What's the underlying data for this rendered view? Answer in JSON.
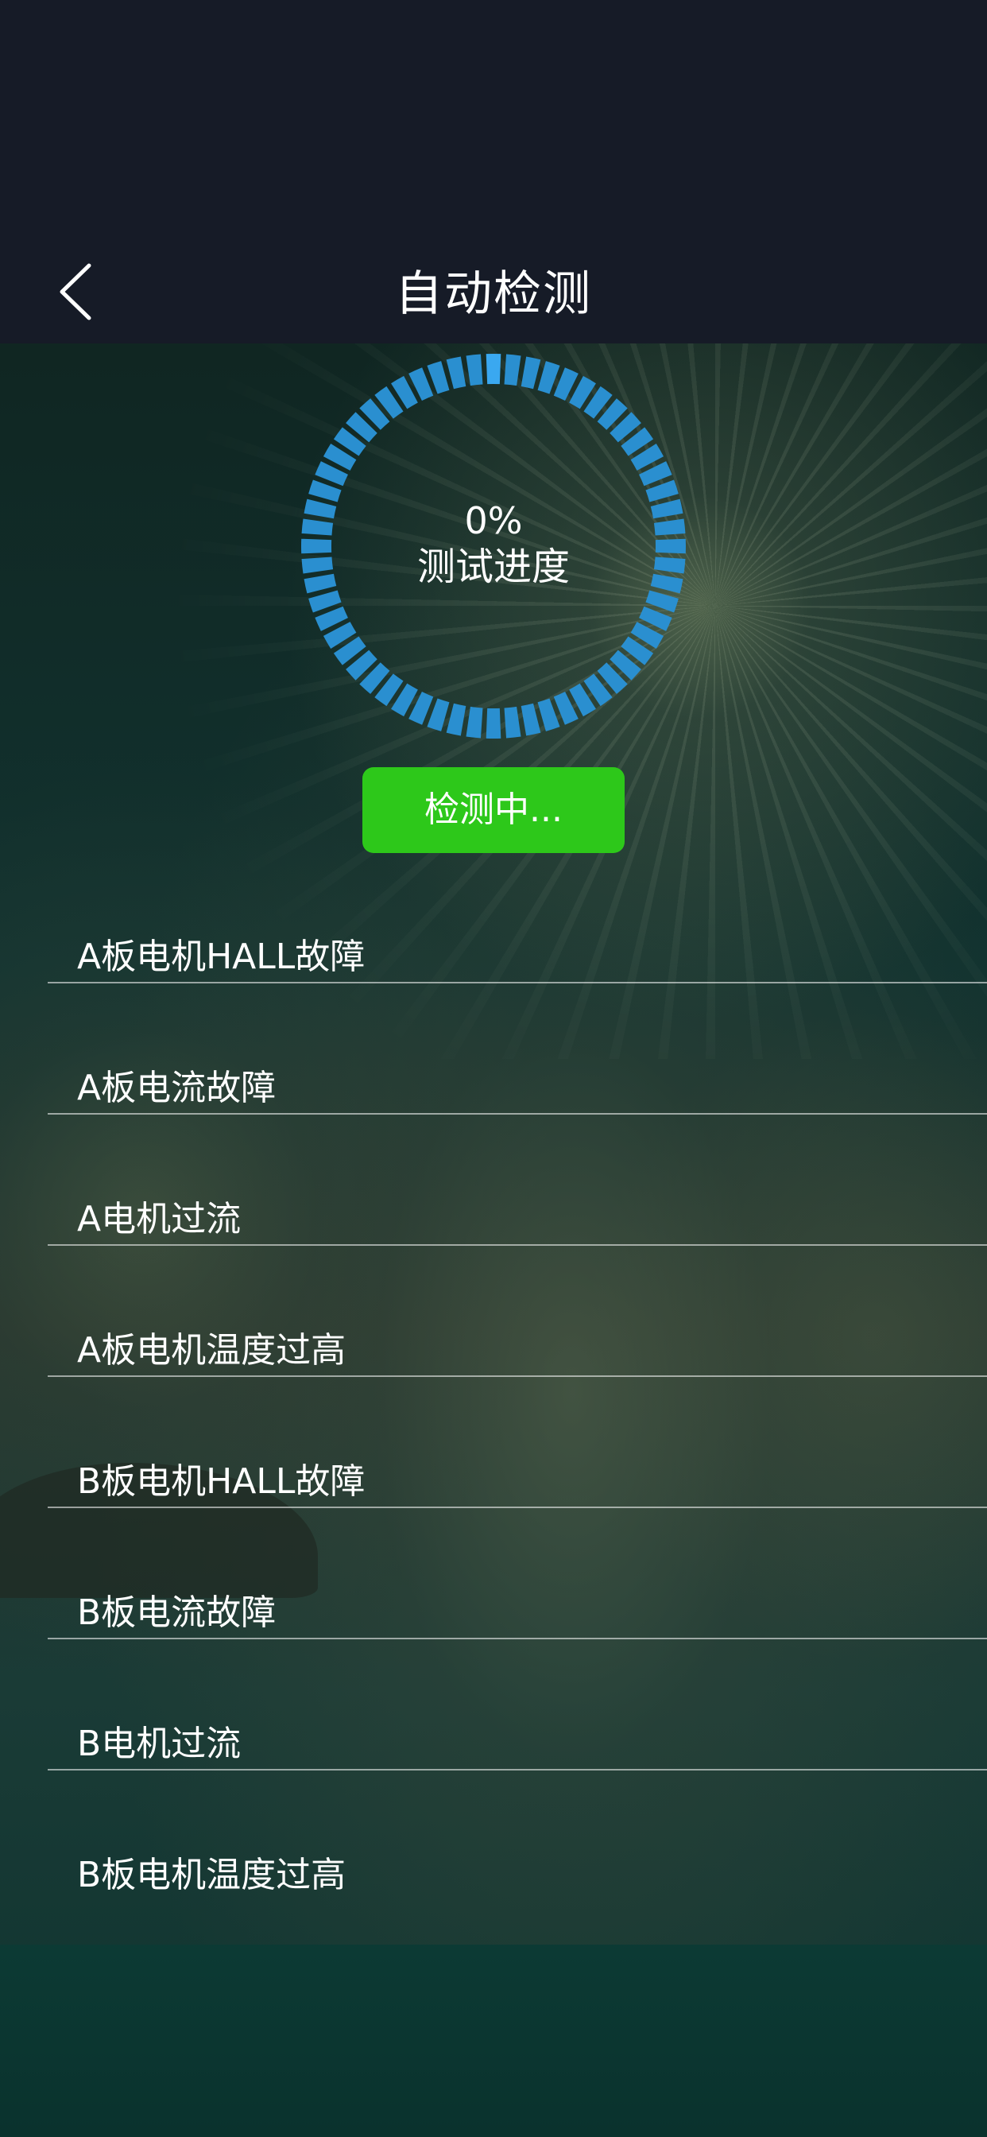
{
  "header": {
    "title": "自动检测",
    "back_icon": "chevron-left-icon"
  },
  "progress": {
    "percent_text": "0%",
    "label": "测试进度",
    "value": 0,
    "ring_color": "#2a8fd0"
  },
  "status_button": {
    "label": "检测中...",
    "color": "#2dc81a"
  },
  "fault_list": [
    {
      "label": "A板电机HALL故障"
    },
    {
      "label": "A板电流故障"
    },
    {
      "label": "A电机过流"
    },
    {
      "label": "A板电机温度过高"
    },
    {
      "label": "B板电机HALL故障"
    },
    {
      "label": "B板电流故障"
    },
    {
      "label": "B电机过流"
    },
    {
      "label": "B板电机温度过高"
    }
  ]
}
